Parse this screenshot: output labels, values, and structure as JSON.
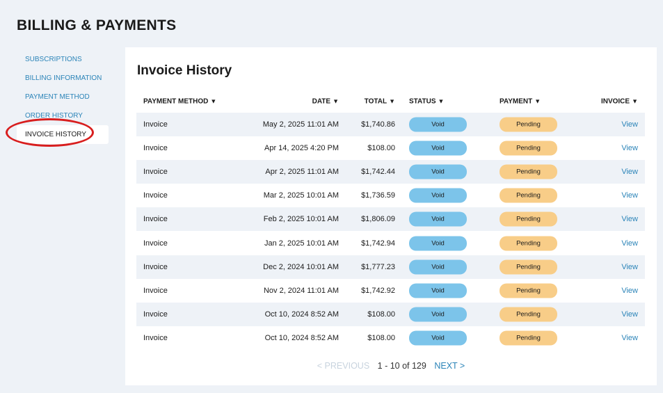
{
  "page": {
    "title": "BILLING & PAYMENTS"
  },
  "sidebar": {
    "items": [
      {
        "label": "SUBSCRIPTIONS"
      },
      {
        "label": "BILLING INFORMATION"
      },
      {
        "label": "PAYMENT METHOD"
      },
      {
        "label": "ORDER HISTORY"
      },
      {
        "label": "INVOICE HISTORY",
        "active": true
      }
    ]
  },
  "card": {
    "title": "Invoice History"
  },
  "table": {
    "headers": {
      "method": "PAYMENT METHOD",
      "date": "DATE",
      "total": "TOTAL",
      "status": "STATUS",
      "payment": "PAYMENT",
      "invoice": "INVOICE",
      "sort_glyph": "▼"
    },
    "rows": [
      {
        "method": "Invoice",
        "date": "May 2, 2025 11:01 AM",
        "total": "$1,740.86",
        "status": "Void",
        "payment": "Pending",
        "invoice": "View"
      },
      {
        "method": "Invoice",
        "date": "Apr 14, 2025 4:20 PM",
        "total": "$108.00",
        "status": "Void",
        "payment": "Pending",
        "invoice": "View"
      },
      {
        "method": "Invoice",
        "date": "Apr 2, 2025 11:01 AM",
        "total": "$1,742.44",
        "status": "Void",
        "payment": "Pending",
        "invoice": "View"
      },
      {
        "method": "Invoice",
        "date": "Mar 2, 2025 10:01 AM",
        "total": "$1,736.59",
        "status": "Void",
        "payment": "Pending",
        "invoice": "View"
      },
      {
        "method": "Invoice",
        "date": "Feb 2, 2025 10:01 AM",
        "total": "$1,806.09",
        "status": "Void",
        "payment": "Pending",
        "invoice": "View"
      },
      {
        "method": "Invoice",
        "date": "Jan 2, 2025 10:01 AM",
        "total": "$1,742.94",
        "status": "Void",
        "payment": "Pending",
        "invoice": "View"
      },
      {
        "method": "Invoice",
        "date": "Dec 2, 2024 10:01 AM",
        "total": "$1,777.23",
        "status": "Void",
        "payment": "Pending",
        "invoice": "View"
      },
      {
        "method": "Invoice",
        "date": "Nov 2, 2024 11:01 AM",
        "total": "$1,742.92",
        "status": "Void",
        "payment": "Pending",
        "invoice": "View"
      },
      {
        "method": "Invoice",
        "date": "Oct 10, 2024 8:52 AM",
        "total": "$108.00",
        "status": "Void",
        "payment": "Pending",
        "invoice": "View"
      },
      {
        "method": "Invoice",
        "date": "Oct 10, 2024 8:52 AM",
        "total": "$108.00",
        "status": "Void",
        "payment": "Pending",
        "invoice": "View"
      }
    ]
  },
  "pagination": {
    "previous": "< PREVIOUS",
    "range": "1 - 10 of 129",
    "next": "NEXT >"
  },
  "colors": {
    "accent": "#2b84b8",
    "void_badge": "#7cc4ea",
    "pending_badge": "#f8cd88",
    "highlight_ring": "#d81e1e",
    "background": "#eef2f7"
  }
}
